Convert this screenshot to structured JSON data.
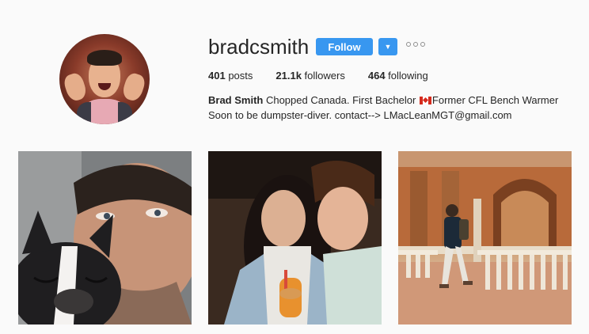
{
  "profile": {
    "username": "bradcsmith",
    "follow_label": "Follow",
    "stats": {
      "posts_count": "401",
      "posts_label": " posts",
      "followers_count": "21.1k",
      "followers_label": " followers",
      "following_count": "464",
      "following_label": " following"
    },
    "bio": {
      "name": "Brad Smith",
      "text_before_flag": " Chopped Canada. First Bachelor ",
      "text_after_flag": "Former CFL Bench Warmer Soon to be dumpster-diver. contact--> LMacLeanMGT@gmail.com"
    }
  },
  "icons": {
    "dropdown": "chevron-down-icon",
    "more": "more-options-icon",
    "flag": "canada-flag-icon"
  },
  "colors": {
    "accent": "#3897f0",
    "background": "#fafafa",
    "text": "#262626"
  },
  "posts": [
    {
      "id": "post-1"
    },
    {
      "id": "post-2"
    },
    {
      "id": "post-3"
    }
  ]
}
